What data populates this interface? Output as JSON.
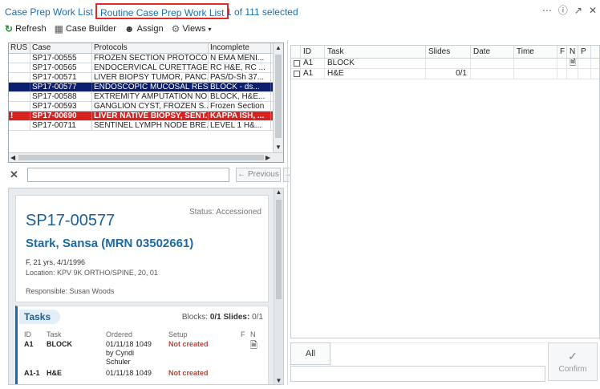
{
  "title": {
    "main": "Case Prep Work List",
    "sep": "-",
    "view": "Routine Case Prep Work List",
    "selection": "1 of 111 selected"
  },
  "window_icons": [
    "ellipsis-icon",
    "help-icon",
    "expand-icon",
    "close-icon"
  ],
  "toolbar": {
    "refresh": "Refresh",
    "case_builder": "Case Builder",
    "assign": "Assign",
    "views": "Views"
  },
  "case_grid": {
    "headers": [
      "RUS",
      "Case",
      "Protocols",
      "Incomplete"
    ],
    "rows": [
      {
        "rus": "",
        "case": "SP17-00555",
        "protocol": "FROZEN SECTION PROTOCO...",
        "incomplete": "N EMA MENI...",
        "state": ""
      },
      {
        "rus": "",
        "case": "SP17-00565",
        "protocol": "ENDOCERVICAL CURETTAGE...",
        "incomplete": "RC H&E, RC ...",
        "state": ""
      },
      {
        "rus": "",
        "case": "SP17-00571",
        "protocol": "LIVER BIOPSY TUMOR, PANC...",
        "incomplete": "PAS/D-Sh 37...",
        "state": ""
      },
      {
        "rus": "",
        "case": "SP17-00577",
        "protocol": "ENDOSCOPIC MUCOSAL RES...",
        "incomplete": "BLOCK - ds...",
        "state": "selected"
      },
      {
        "rus": "",
        "case": "SP17-00588",
        "protocol": "EXTREMITY AMPUTATION NO...",
        "incomplete": "BLOCK, H&E...",
        "state": ""
      },
      {
        "rus": "",
        "case": "SP17-00593",
        "protocol": "GANGLION CYST, FROZEN S...",
        "incomplete": "Frozen Section",
        "state": ""
      },
      {
        "rus": "!",
        "case": "SP17-00690",
        "protocol": "LIVER NATIVE BIOPSY, SENT...",
        "incomplete": "KAPPA ISH, ...",
        "state": "alert"
      },
      {
        "rus": "",
        "case": "SP17-00711",
        "protocol": "SENTINEL LYMPH NODE BRE...",
        "incomplete": "LEVEL 1 H&...",
        "state": ""
      }
    ]
  },
  "search": {
    "value": "",
    "placeholder": "",
    "previous": "Previous",
    "next": "N"
  },
  "detail": {
    "case_number": "SP17-00577",
    "status": "Status: Accessioned",
    "patient": "Stark, Sansa (MRN 03502661)",
    "demographics": "F, 21 yrs, 4/1/1996",
    "location": "Location: KPV 9K ORTHO/SPINE, 20, 01",
    "responsible": "Responsible: Susan Woods"
  },
  "tasks_card": {
    "title": "Tasks",
    "blocks_label": "Blocks:",
    "blocks": "0/1",
    "slides_label": "Slides:",
    "slides": "0/1",
    "headers": {
      "id": "ID",
      "task": "Task",
      "ordered": "Ordered",
      "setup": "Setup",
      "f": "F",
      "n": "N"
    },
    "rows": [
      {
        "id": "A1",
        "task": "BLOCK",
        "ordered_1": "01/11/18 1049",
        "ordered_2": "by Cyndi",
        "ordered_3": "Schuler",
        "setup": "Not created"
      },
      {
        "id": "A1-1",
        "task": "H&E",
        "ordered_1": "01/11/18 1049",
        "setup": "Not created"
      }
    ]
  },
  "task_grid": {
    "headers": [
      "",
      "ID",
      "Task",
      "Slides",
      "Date",
      "Time",
      "F",
      "N",
      "P"
    ],
    "rows": [
      {
        "id": "A1",
        "task": "BLOCK",
        "slides": "",
        "date": "",
        "time": ""
      },
      {
        "id": "A1",
        "task": "H&E",
        "slides": "0/1",
        "date": "",
        "time": ""
      }
    ]
  },
  "actions": {
    "all": "All",
    "confirm": "Confirm"
  },
  "colors": {
    "accent": "#1a6fb0",
    "selected_row": "#0c1e6e",
    "alert_row": "#d8221f",
    "not_created": "#d23a2a"
  }
}
